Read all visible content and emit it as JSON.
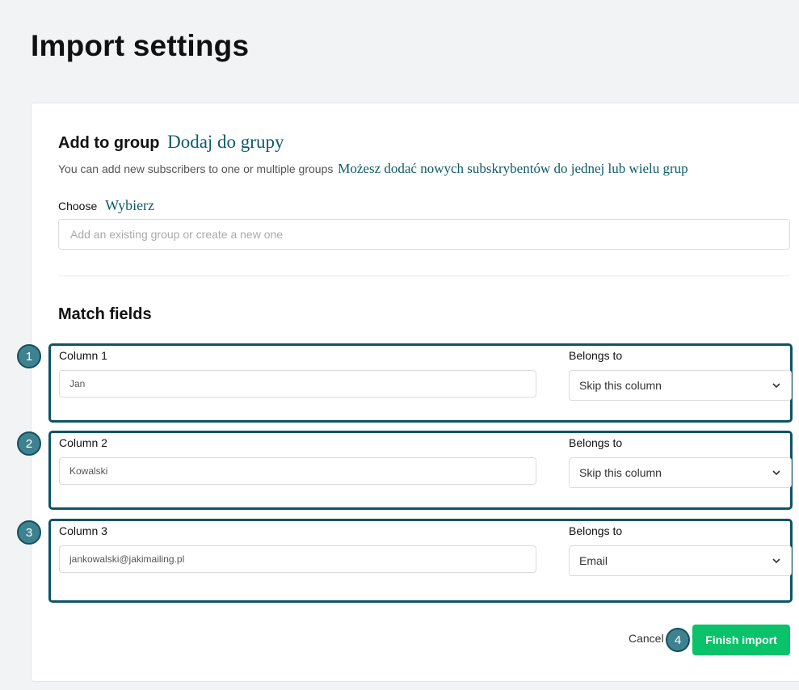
{
  "page": {
    "title": "Import settings"
  },
  "group": {
    "title": "Add to group",
    "title_translation": "Dodaj do grupy",
    "subtitle": "You can add new subscribers to one or multiple groups",
    "subtitle_translation": "Możesz dodać nowych subskrybentów do jednej lub wielu grup",
    "choose_label": "Choose",
    "choose_translation": "Wybierz",
    "input_placeholder": "Add an existing group or create a new one",
    "input_value": ""
  },
  "match": {
    "title": "Match fields",
    "rows": [
      {
        "step": "1",
        "column_label": "Column 1",
        "column_value": "Jan",
        "belongs_label": "Belongs to",
        "selected": "Skip this column"
      },
      {
        "step": "2",
        "column_label": "Column 2",
        "column_value": "Kowalski",
        "belongs_label": "Belongs to",
        "selected": "Skip this column"
      },
      {
        "step": "3",
        "column_label": "Column 3",
        "column_value": "jankowalski@jakimailing.pl",
        "belongs_label": "Belongs to",
        "selected": "Email"
      }
    ]
  },
  "actions": {
    "cancel_label": "Cancel",
    "finish_label": "Finish import",
    "finish_step": "4"
  },
  "colors": {
    "accent_green": "#09c269",
    "highlight_border": "#0c5566",
    "step_badge": "#3e8290",
    "translation_text": "#0e5a6a"
  },
  "icons": {
    "select_chevron": "chevron-down-icon"
  }
}
